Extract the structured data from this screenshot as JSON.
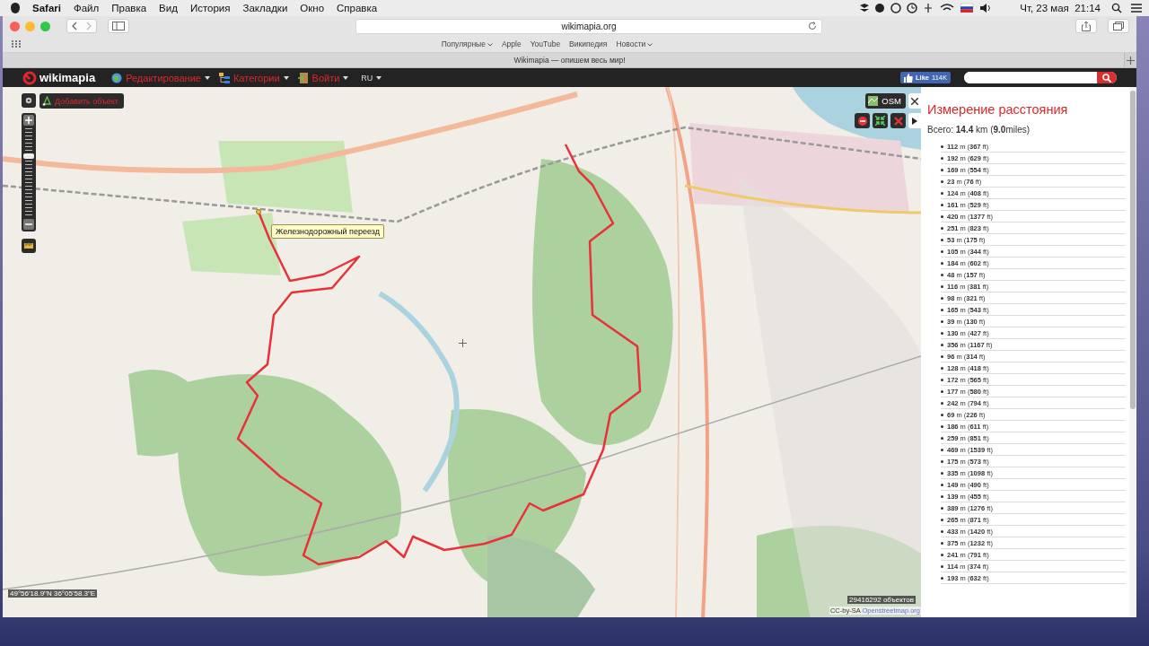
{
  "menu_bar": {
    "app": "Safari",
    "items": [
      "Файл",
      "Правка",
      "Вид",
      "История",
      "Закладки",
      "Окно",
      "Справка"
    ],
    "clock": "Чт, 23 мая  21:14"
  },
  "browser": {
    "url": "wikimapia.org",
    "bookmarks": [
      {
        "label": "Популярные",
        "dropdown": true
      },
      {
        "label": "Apple",
        "dropdown": false
      },
      {
        "label": "YouTube",
        "dropdown": false
      },
      {
        "label": "Википедия",
        "dropdown": false
      },
      {
        "label": "Новости",
        "dropdown": true
      }
    ],
    "tab_title": "Wikimapia — опишем весь мир!"
  },
  "site_header": {
    "logo": "wikimapia",
    "nav": [
      {
        "label": "Редактирование",
        "dropdown": true
      },
      {
        "label": "Категории",
        "dropdown": true
      },
      {
        "label": "Войти",
        "dropdown": true
      }
    ],
    "language": "RU",
    "like": {
      "label": "Like",
      "count": "114K"
    }
  },
  "map": {
    "zoom": {
      "level": 0.68
    },
    "add_object": "Добавить объект",
    "layer": "OSM",
    "tooltip": "Железнодорожный переезд",
    "coordinates": "49°56'18.9\"N 36°05'58.3\"E",
    "object_count": "29416292 объектов",
    "license": "CC-by-SA",
    "license_link": "Openstreetmap.org"
  },
  "measure_panel": {
    "title": "Измерение расстояния",
    "total": "Всего: **14.4** km (**9.0**miles)",
    "segments": [
      "**112** m (**367** ft)",
      "**192** m (**629** ft)",
      "**169** m (**554** ft)",
      "**23** m (**76** ft)",
      "**124** m (**408** ft)",
      "**161** m (**529** ft)",
      "**420** m (**1377** ft)",
      "**251** m (**823** ft)",
      "**53** m (**175** ft)",
      "**105** m (**344** ft)",
      "**184** m (**602** ft)",
      "**48** m (**157** ft)",
      "**116** m (**381** ft)",
      "**98** m (**321** ft)",
      "**165** m (**543** ft)",
      "**39** m (**130** ft)",
      "**130** m (**427** ft)",
      "**356** m (**1167** ft)",
      "**96** m (**314** ft)",
      "**128** m (**418** ft)",
      "**172** m (**565** ft)",
      "**177** m (**580** ft)",
      "**242** m (**794** ft)",
      "**69** m (**226** ft)",
      "**186** m (**611** ft)",
      "**259** m (**851** ft)",
      "**469** m (**1539** ft)",
      "**175** m (**573** ft)",
      "**335** m (**1098** ft)",
      "**149** m (**490** ft)",
      "**139** m (**455** ft)",
      "**389** m (**1276** ft)",
      "**265** m (**871** ft)",
      "**433** m (**1420** ft)",
      "**375** m (**1232** ft)",
      "**241** m (**791** ft)",
      "**114** m (**374** ft)",
      "**193** m (**632** ft)"
    ]
  }
}
